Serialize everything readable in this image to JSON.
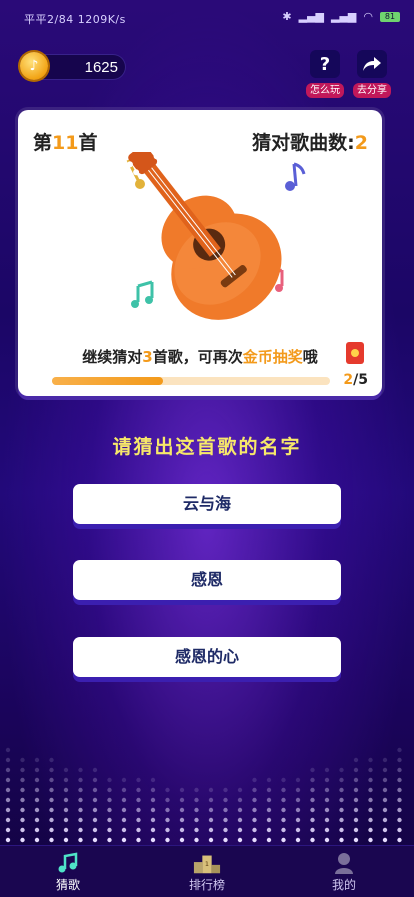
{
  "status_bar": {
    "left_text": "平平2/84 1209K/s",
    "battery": "81"
  },
  "header": {
    "coins": "1625",
    "help_label": "怎么玩",
    "share_label": "去分享"
  },
  "card": {
    "level_prefix": "第",
    "level_num": "11",
    "level_suffix": "首",
    "guessed_label": "猜对歌曲数:",
    "guessed_count": "2",
    "tip_a": "继续猜对",
    "tip_num": "3",
    "tip_b": "首歌，可再次",
    "tip_c": "金币抽奖",
    "tip_d": "哦",
    "progress_current": "2",
    "progress_total": "/5",
    "progress_fraction": 0.4
  },
  "question": "请猜出这首歌的名字",
  "answers": [
    "云与海",
    "感恩",
    "感恩的心"
  ],
  "tabs": [
    {
      "label": "猜歌",
      "icon": "music-note-icon",
      "active": true
    },
    {
      "label": "排行榜",
      "icon": "podium-icon",
      "active": false
    },
    {
      "label": "我的",
      "icon": "user-icon",
      "active": false
    }
  ],
  "colors": {
    "accent": "#f39a1b",
    "question": "#f7e86a",
    "answer_text": "#1e2a66",
    "tab_active": "#4fe3c8"
  }
}
